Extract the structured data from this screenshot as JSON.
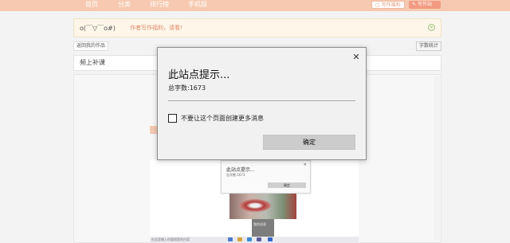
{
  "nav": {
    "items": [
      "首页",
      "分类",
      "排行榜",
      "手机版"
    ],
    "write_code_label": "写作福利",
    "write_draft_label": "写作站"
  },
  "notice": {
    "emote": "o(￣▽￣o#)",
    "message": "作者写作福利，请看!"
  },
  "toolbar": {
    "back_label": "返回我的作品",
    "stats_label": "字数统计"
  },
  "title_input": {
    "value": "频上补课"
  },
  "mini_screenshot": {
    "dialog_title": "此站点提示...",
    "dialog_sub": "总字数:1673",
    "ok_label": "确定",
    "dark_text": "我的消息",
    "taskbar_text": "在这里输入你要搜索的内容"
  },
  "modal": {
    "title": "此站点提示...",
    "message": "总字数:1673",
    "checkbox_label": "不要让这个页面创建更多消息",
    "ok_label": "确定"
  },
  "colors": {
    "nav_bg": "#f7c9b0",
    "accent": "#f29b82",
    "notice_text": "#e1896a"
  }
}
